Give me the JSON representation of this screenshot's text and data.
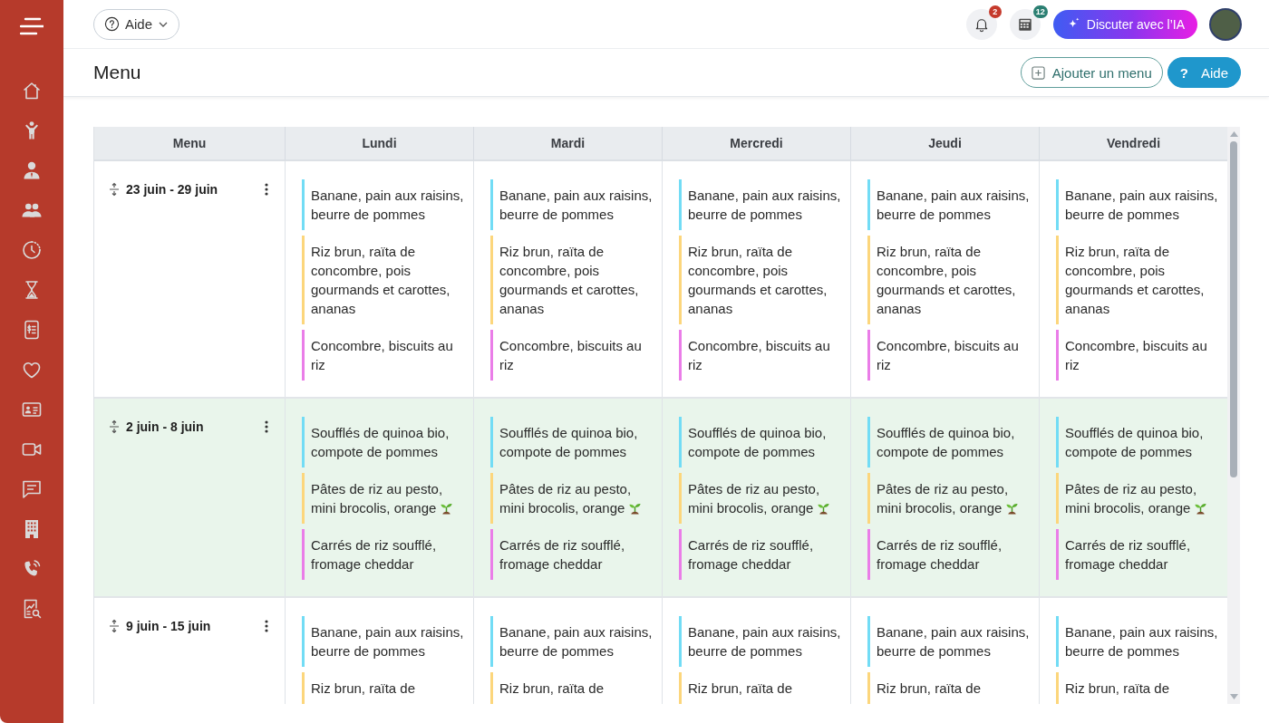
{
  "sidebar": {
    "items": [
      {
        "kind": "home"
      },
      {
        "kind": "child"
      },
      {
        "kind": "user"
      },
      {
        "kind": "users"
      },
      {
        "kind": "clock"
      },
      {
        "kind": "hourglass"
      },
      {
        "kind": "invoice"
      },
      {
        "kind": "heart"
      },
      {
        "kind": "id_card"
      },
      {
        "kind": "video"
      },
      {
        "kind": "chat"
      },
      {
        "kind": "building"
      },
      {
        "kind": "phone"
      },
      {
        "kind": "report"
      }
    ]
  },
  "top_bar": {
    "help_menu": {
      "label": "Aide"
    },
    "notifications": {
      "count": "2"
    },
    "calculator": {
      "count": "12"
    },
    "ai_button": {
      "label": "Discuter avec l’IA"
    }
  },
  "page_header": {
    "title": "Menu",
    "buttons": [
      {
        "kind": "add",
        "label": "Ajouter un menu"
      },
      {
        "kind": "help",
        "symbol": "?",
        "label": "Aide"
      }
    ]
  },
  "table": {
    "columns": [
      "Menu",
      "Lundi",
      "Mardi",
      "Mercredi",
      "Jeudi",
      "Vendredi"
    ],
    "rows": [
      {
        "week": "23 juin - 29 juin",
        "highlighted": false,
        "days": [
          {
            "items": [
              {
                "kind": "plain",
                "text": "Banane, pain aux raisins, beurre de pommes",
                "color": "#72dcf5"
              },
              {
                "kind": "plain",
                "text": "Riz brun, raïta de concombre, pois gourmands et carottes, ananas",
                "color": "#fcd67c"
              },
              {
                "kind": "plain",
                "text": "Concombre, biscuits au riz",
                "color": "#ea7de8"
              }
            ]
          },
          {
            "items": [
              {
                "kind": "plain",
                "text": "Banane, pain aux raisins, beurre de pommes",
                "color": "#72dcf5"
              },
              {
                "kind": "plain",
                "text": "Riz brun, raïta de concombre, pois gourmands et carottes, ananas",
                "color": "#fcd67c"
              },
              {
                "kind": "plain",
                "text": "Concombre, biscuits au riz",
                "color": "#ea7de8"
              }
            ]
          },
          {
            "items": [
              {
                "kind": "plain",
                "text": "Banane, pain aux raisins, beurre de pommes",
                "color": "#72dcf5"
              },
              {
                "kind": "plain",
                "text": "Riz brun, raïta de concombre, pois gourmands et carottes, ananas",
                "color": "#fcd67c"
              },
              {
                "kind": "plain",
                "text": "Concombre, biscuits au riz",
                "color": "#ea7de8"
              }
            ]
          },
          {
            "items": [
              {
                "kind": "plain",
                "text": "Banane, pain aux raisins, beurre de pommes",
                "color": "#72dcf5"
              },
              {
                "kind": "plain",
                "text": "Riz brun, raïta de concombre, pois gourmands et carottes, ananas",
                "color": "#fcd67c"
              },
              {
                "kind": "plain",
                "text": "Concombre, biscuits au riz",
                "color": "#ea7de8"
              }
            ]
          },
          {
            "items": [
              {
                "kind": "plain",
                "text": "Banane, pain aux raisins, beurre de pommes",
                "color": "#72dcf5"
              },
              {
                "kind": "plain",
                "text": "Riz brun, raïta de concombre, pois gourmands et carottes, ananas",
                "color": "#fcd67c"
              },
              {
                "kind": "plain",
                "text": "Concombre, biscuits au riz",
                "color": "#ea7de8"
              }
            ]
          }
        ]
      },
      {
        "week": "2 juin - 8 juin",
        "highlighted": true,
        "days": [
          {
            "items": [
              {
                "kind": "plain",
                "text": "Soufflés de quinoa bio, compote de pommes",
                "color": "#72dcf5"
              },
              {
                "kind": "seedling",
                "text": "Pâtes de riz au pesto, mini brocolis, orange",
                "color": "#fcd67c"
              },
              {
                "kind": "plain",
                "text": "Carrés de riz soufflé, fromage cheddar",
                "color": "#ea7de8"
              }
            ]
          },
          {
            "items": [
              {
                "kind": "plain",
                "text": "Soufflés de quinoa bio, compote de pommes",
                "color": "#72dcf5"
              },
              {
                "kind": "seedling",
                "text": "Pâtes de riz au pesto, mini brocolis, orange",
                "color": "#fcd67c"
              },
              {
                "kind": "plain",
                "text": "Carrés de riz soufflé, fromage cheddar",
                "color": "#ea7de8"
              }
            ]
          },
          {
            "items": [
              {
                "kind": "plain",
                "text": "Soufflés de quinoa bio, compote de pommes",
                "color": "#72dcf5"
              },
              {
                "kind": "seedling",
                "text": "Pâtes de riz au pesto, mini brocolis, orange",
                "color": "#fcd67c"
              },
              {
                "kind": "plain",
                "text": "Carrés de riz soufflé, fromage cheddar",
                "color": "#ea7de8"
              }
            ]
          },
          {
            "items": [
              {
                "kind": "plain",
                "text": "Soufflés de quinoa bio, compote de pommes",
                "color": "#72dcf5"
              },
              {
                "kind": "seedling",
                "text": "Pâtes de riz au pesto, mini brocolis, orange",
                "color": "#fcd67c"
              },
              {
                "kind": "plain",
                "text": "Carrés de riz soufflé, fromage cheddar",
                "color": "#ea7de8"
              }
            ]
          },
          {
            "items": [
              {
                "kind": "plain",
                "text": "Soufflés de quinoa bio, compote de pommes",
                "color": "#72dcf5"
              },
              {
                "kind": "seedling",
                "text": "Pâtes de riz au pesto, mini brocolis, orange",
                "color": "#fcd67c"
              },
              {
                "kind": "plain",
                "text": "Carrés de riz soufflé, fromage cheddar",
                "color": "#ea7de8"
              }
            ]
          }
        ]
      },
      {
        "week": "9 juin - 15 juin",
        "highlighted": false,
        "days": [
          {
            "items": [
              {
                "kind": "plain",
                "text": "Banane, pain aux raisins, beurre de pommes",
                "color": "#72dcf5"
              },
              {
                "kind": "plain",
                "text": "Riz brun, raïta de",
                "color": "#fcd67c"
              }
            ]
          },
          {
            "items": [
              {
                "kind": "plain",
                "text": "Banane, pain aux raisins, beurre de pommes",
                "color": "#72dcf5"
              },
              {
                "kind": "plain",
                "text": "Riz brun, raïta de",
                "color": "#fcd67c"
              }
            ]
          },
          {
            "items": [
              {
                "kind": "plain",
                "text": "Banane, pain aux raisins, beurre de pommes",
                "color": "#72dcf5"
              },
              {
                "kind": "plain",
                "text": "Riz brun, raïta de",
                "color": "#fcd67c"
              }
            ]
          },
          {
            "items": [
              {
                "kind": "plain",
                "text": "Banane, pain aux raisins, beurre de pommes",
                "color": "#72dcf5"
              },
              {
                "kind": "plain",
                "text": "Riz brun, raïta de",
                "color": "#fcd67c"
              }
            ]
          },
          {
            "items": [
              {
                "kind": "plain",
                "text": "Banane, pain aux raisins, beurre de pommes",
                "color": "#72dcf5"
              },
              {
                "kind": "plain",
                "text": "Riz brun, raïta de",
                "color": "#fcd67c"
              }
            ]
          }
        ]
      }
    ]
  }
}
